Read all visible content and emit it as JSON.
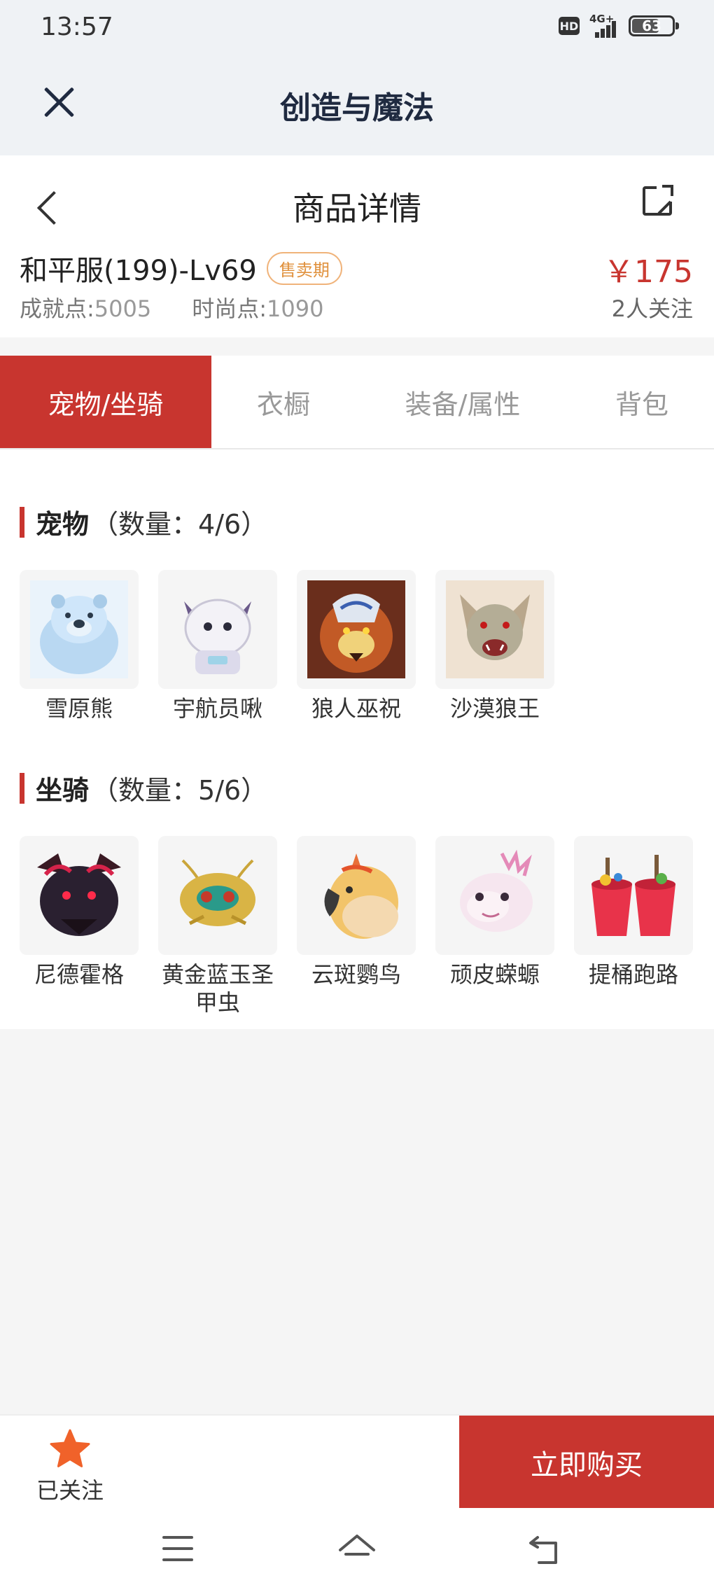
{
  "status_bar": {
    "time": "13:57",
    "hd": "HD",
    "network": "4G+",
    "battery": "63"
  },
  "app_header": {
    "title": "创造与魔法"
  },
  "product": {
    "page_title": "商品详情",
    "name": "和平服(199)-Lv69",
    "badge": "售卖期",
    "price": "￥175",
    "achievement_label": "成就点:",
    "achievement_value": "5005",
    "fashion_label": "时尚点:",
    "fashion_value": "1090",
    "follow_count": "2人关注"
  },
  "tabs": [
    {
      "label": "宠物/坐骑",
      "active": true
    },
    {
      "label": "衣橱",
      "active": false
    },
    {
      "label": "装备/属性",
      "active": false
    },
    {
      "label": "背包",
      "active": false
    }
  ],
  "pets": {
    "title": "宠物",
    "count": "（数量：4/6）",
    "items": [
      {
        "name": "雪原熊",
        "icon": "snow-bear-icon"
      },
      {
        "name": "宇航员啾",
        "icon": "astronaut-bird-icon"
      },
      {
        "name": "狼人巫祝",
        "icon": "werewolf-shaman-icon"
      },
      {
        "name": "沙漠狼王",
        "icon": "desert-wolf-king-icon"
      }
    ]
  },
  "mounts": {
    "title": "坐骑",
    "count": "（数量：5/6）",
    "items": [
      {
        "name": "尼德霍格",
        "icon": "nidhogg-dragon-icon"
      },
      {
        "name": "黄金蓝玉圣甲虫",
        "icon": "golden-scarab-icon"
      },
      {
        "name": "云斑鹦鸟",
        "icon": "parrot-icon"
      },
      {
        "name": "顽皮蝾螈",
        "icon": "axolotl-icon"
      },
      {
        "name": "提桶跑路",
        "icon": "buckets-icon"
      }
    ]
  },
  "action_bar": {
    "follow_label": "已关注",
    "buy_label": "立即购买"
  },
  "colors": {
    "accent": "#c8352f",
    "badge": "#e0913d",
    "star": "#f0622a"
  }
}
